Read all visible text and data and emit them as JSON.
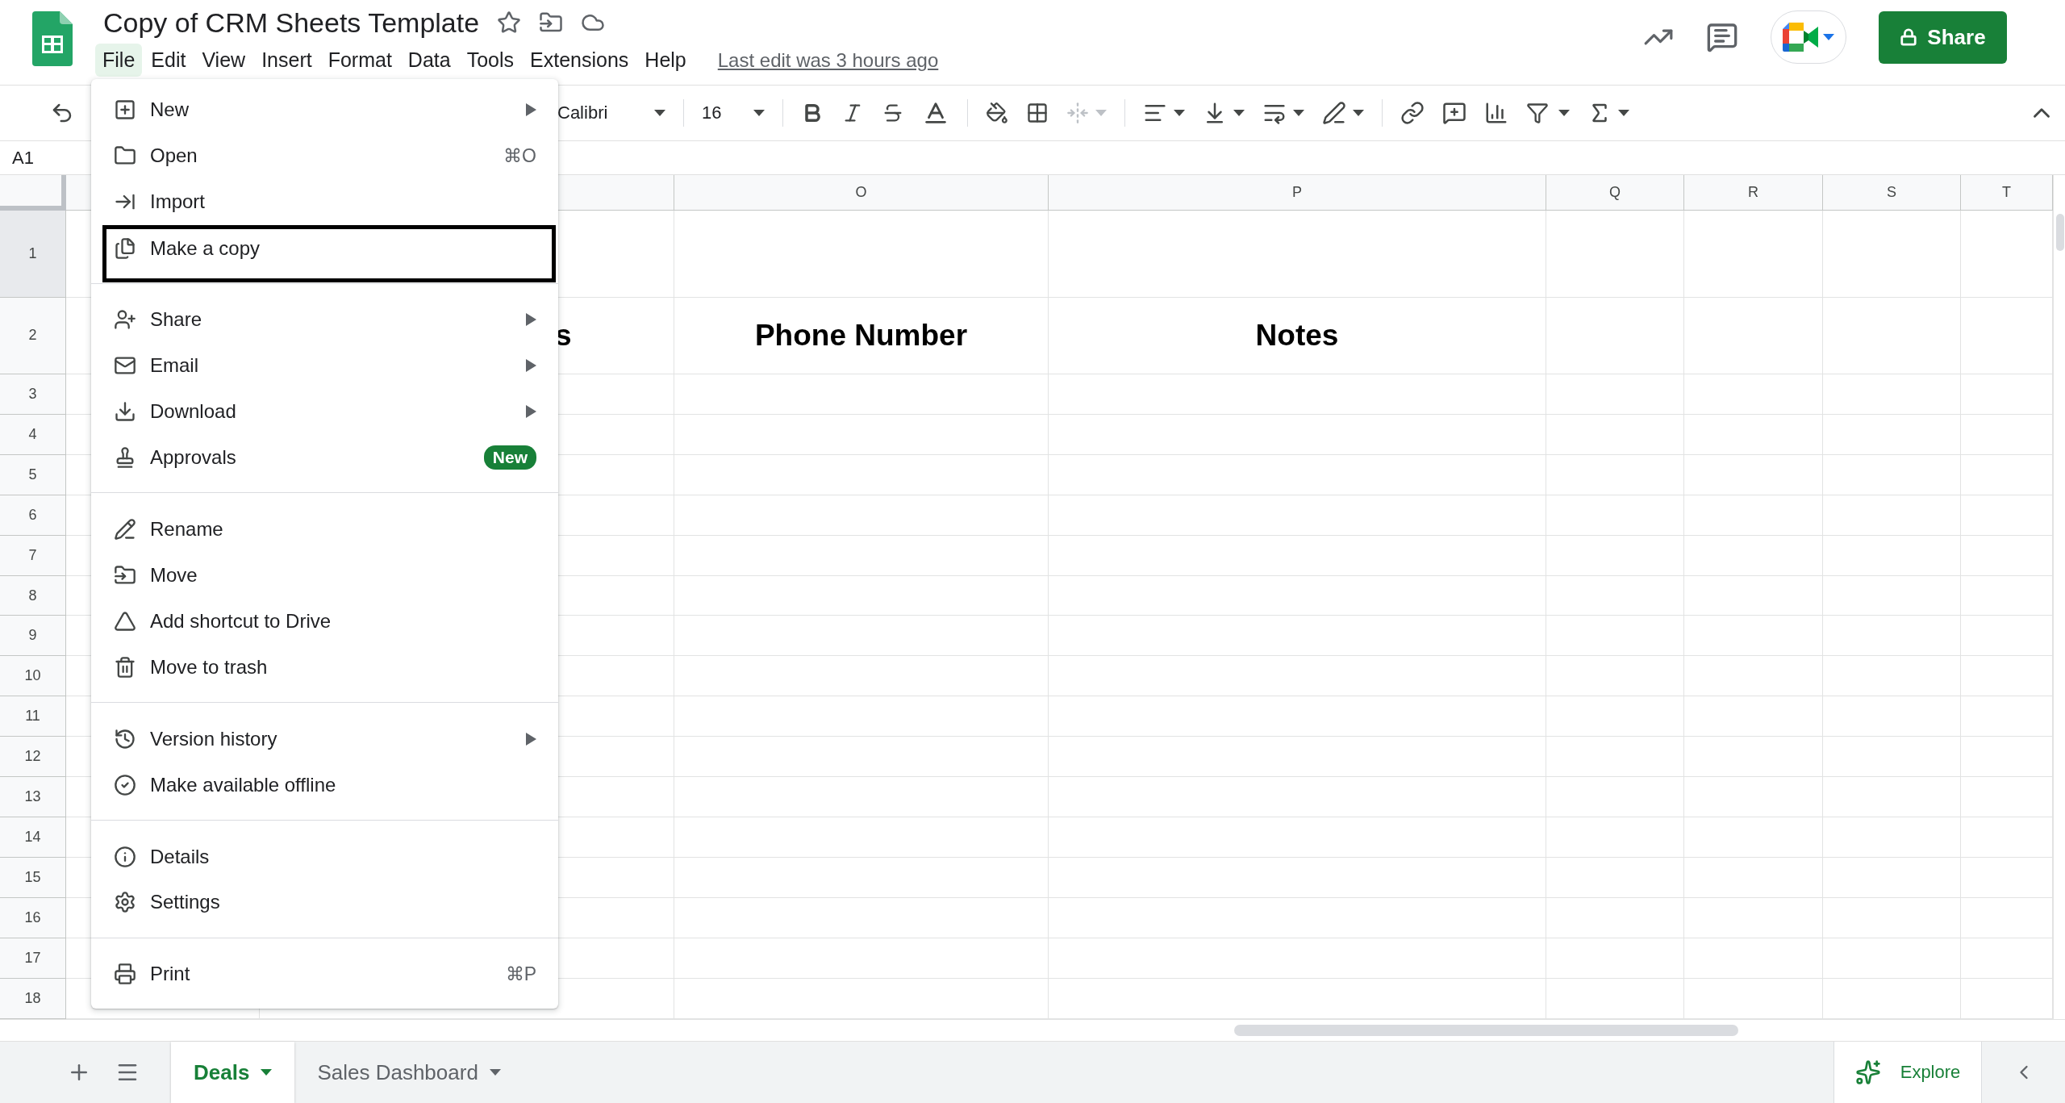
{
  "document": {
    "title": "Copy of CRM Sheets Template",
    "last_edit": "Last edit was 3 hours ago"
  },
  "menu_bar": [
    {
      "label": "File",
      "selected": true
    },
    {
      "label": "Edit",
      "selected": false
    },
    {
      "label": "View",
      "selected": false
    },
    {
      "label": "Insert",
      "selected": false
    },
    {
      "label": "Format",
      "selected": false
    },
    {
      "label": "Data",
      "selected": false
    },
    {
      "label": "Tools",
      "selected": false
    },
    {
      "label": "Extensions",
      "selected": false
    },
    {
      "label": "Help",
      "selected": false
    }
  ],
  "share_button": {
    "label": "Share"
  },
  "toolbar": {
    "font": "Calibri",
    "font_size": "16"
  },
  "name_box": "A1",
  "columns": [
    "O",
    "P",
    "Q",
    "R",
    "S",
    "T"
  ],
  "rows": [
    {
      "number": "1",
      "selected": true
    },
    {
      "number": "2",
      "selected": false,
      "cells": [
        "s",
        "Phone Number",
        "Notes"
      ]
    },
    {
      "number": "3",
      "selected": false
    },
    {
      "number": "4",
      "selected": false
    },
    {
      "number": "5",
      "selected": false
    },
    {
      "number": "6",
      "selected": false
    },
    {
      "number": "7",
      "selected": false
    },
    {
      "number": "8",
      "selected": false
    },
    {
      "number": "9",
      "selected": false
    },
    {
      "number": "10",
      "selected": false
    },
    {
      "number": "11",
      "selected": false
    },
    {
      "number": "12",
      "selected": false
    },
    {
      "number": "13",
      "selected": false
    },
    {
      "number": "14",
      "selected": false
    },
    {
      "number": "15",
      "selected": false
    },
    {
      "number": "16",
      "selected": false
    },
    {
      "number": "17",
      "selected": false
    },
    {
      "number": "18",
      "selected": false
    }
  ],
  "file_menu": [
    {
      "items": [
        {
          "label": "New",
          "submenu": true,
          "focused": false
        },
        {
          "label": "Open",
          "submenu": false,
          "focused": false,
          "shortcut": "⌘O"
        },
        {
          "label": "Import",
          "submenu": false,
          "focused": false
        },
        {
          "label": "Make a copy",
          "submenu": false,
          "focused": true
        }
      ]
    },
    {
      "items": [
        {
          "label": "Share",
          "submenu": true,
          "focused": false
        },
        {
          "label": "Email",
          "submenu": true,
          "focused": false
        },
        {
          "label": "Download",
          "submenu": true,
          "focused": false
        },
        {
          "label": "Approvals",
          "submenu": false,
          "focused": false,
          "badge": "New"
        }
      ]
    },
    {
      "items": [
        {
          "label": "Rename",
          "submenu": false,
          "focused": false
        },
        {
          "label": "Move",
          "submenu": false,
          "focused": false
        },
        {
          "label": "Add shortcut to Drive",
          "submenu": false,
          "focused": false
        },
        {
          "label": "Move to trash",
          "submenu": false,
          "focused": false
        }
      ]
    },
    {
      "items": [
        {
          "label": "Version history",
          "submenu": true,
          "focused": false
        },
        {
          "label": "Make available offline",
          "submenu": false,
          "focused": false
        }
      ]
    },
    {
      "items": [
        {
          "label": "Details",
          "submenu": false,
          "focused": false
        },
        {
          "label": "Settings",
          "submenu": false,
          "focused": false
        }
      ]
    },
    {
      "items": [
        {
          "label": "Print",
          "submenu": false,
          "focused": false,
          "shortcut": "⌘P"
        }
      ]
    }
  ],
  "sheet_tabs": [
    {
      "label": "Deals",
      "selected": true
    },
    {
      "label": "Sales Dashboard",
      "selected": false
    }
  ],
  "explore_button": {
    "label": "Explore"
  }
}
